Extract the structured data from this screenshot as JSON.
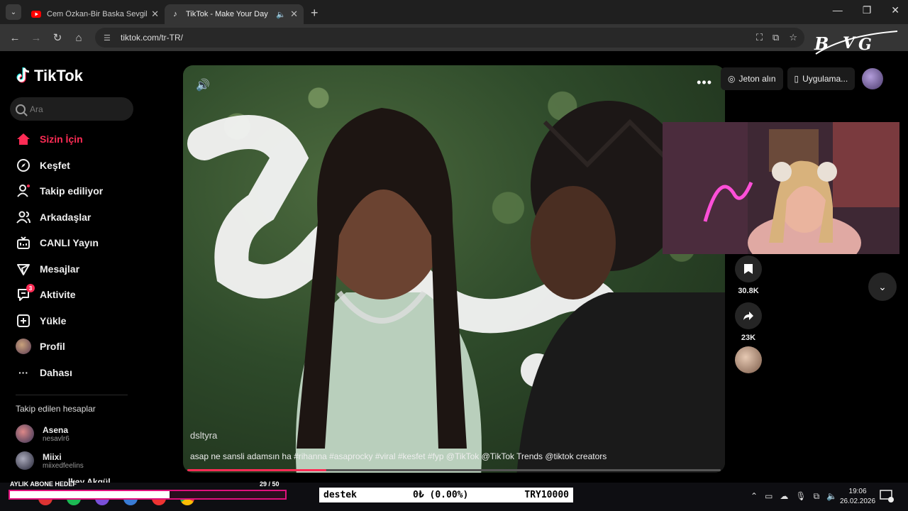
{
  "browser": {
    "tabs": [
      {
        "title": "Cem Özkan-Bir Baska Sevgiliyi S",
        "favicon": "youtube-icon"
      },
      {
        "title": "TikTok - Make Your Day",
        "favicon": "tiktok-icon"
      }
    ],
    "url": "tiktok.com/tr-TR/"
  },
  "tiktok": {
    "logo": "TikTok",
    "search_placeholder": "Ara",
    "nav": [
      {
        "label": "Sizin İçin",
        "icon": "home-icon"
      },
      {
        "label": "Keşfet",
        "icon": "compass-icon"
      },
      {
        "label": "Takip ediliyor",
        "icon": "following-icon"
      },
      {
        "label": "Arkadaşlar",
        "icon": "friends-icon"
      },
      {
        "label": "CANLI Yayın",
        "icon": "live-icon"
      },
      {
        "label": "Mesajlar",
        "icon": "messages-icon"
      },
      {
        "label": "Aktivite",
        "icon": "activity-icon",
        "badge": "3"
      },
      {
        "label": "Yükle",
        "icon": "upload-icon"
      },
      {
        "label": "Profil",
        "icon": "profile-avatar"
      },
      {
        "label": "Dahası",
        "icon": "more-icon"
      }
    ],
    "following_title": "Takip edilen hesaplar",
    "accounts": [
      {
        "name": "Asena",
        "handle": "nesavlr6"
      },
      {
        "name": "Miixi",
        "handle": "miixedfeelins"
      },
      {
        "name": "lkay Akgül",
        "handle": ""
      }
    ],
    "top_right": {
      "coins": "Jeton alın",
      "app": "Uygulama..."
    },
    "video": {
      "username": "dsltyra",
      "caption": "asap ne sansli adamsın ha #rihanna #asaprocky #viral #kesfet #fyp @TikTok @TikTok Trends @tiktok creators",
      "progress": 0.26
    },
    "actions": {
      "saves": "30.8K",
      "shares": "23K"
    }
  },
  "stream_overlay": {
    "goal_label": "AYLIK ABONE HEDEF",
    "goal_count": "29  / 50",
    "goal_progress": 0.58,
    "donate_label": "destek",
    "donate_amount": "0₺ (0.00%)",
    "donate_target": "TRY10000",
    "logo_text": "BVG"
  },
  "taskbar": {
    "time": "19:06",
    "date": "26.02.2026",
    "notifications": "1"
  },
  "colors": {
    "accent": "#fe2c55",
    "goal_border": "#e0117d"
  }
}
